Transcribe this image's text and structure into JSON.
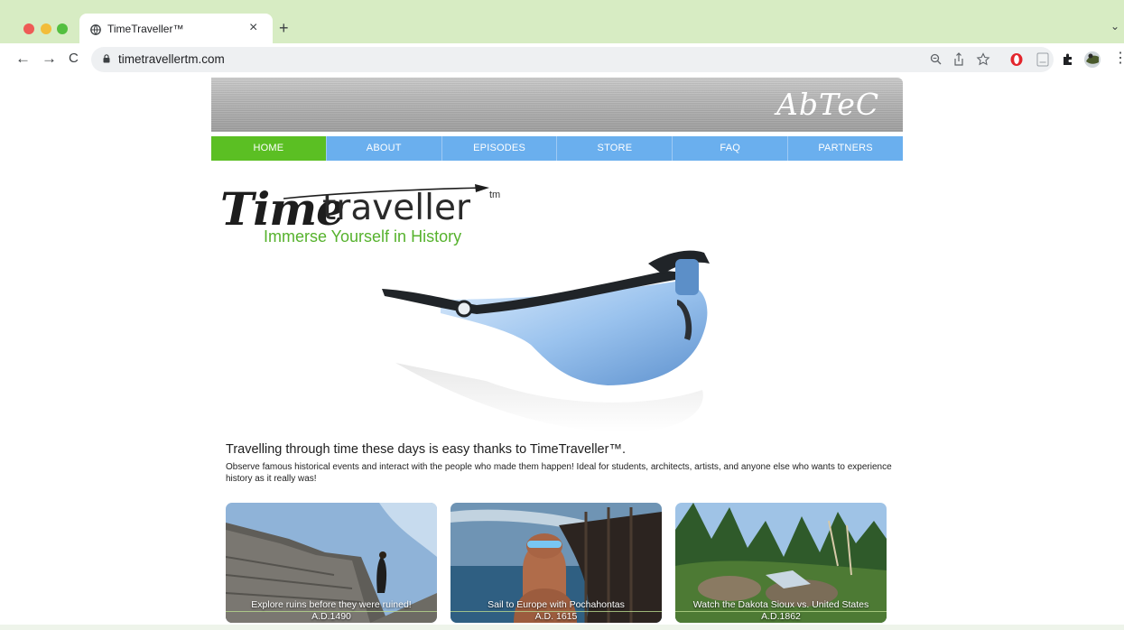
{
  "browser": {
    "tab_title": "TimeTraveller™",
    "tab_close": "×",
    "new_tab": "+",
    "tabs_menu": "⌄",
    "url": "timetravellertm.com",
    "nav": {
      "back": "←",
      "forward": "→",
      "reload": "C"
    },
    "toolbar_icons": [
      "zoom-icon",
      "share-icon",
      "bookmark-star-icon",
      "opera-icon",
      "document-icon",
      "extensions-puzzle-icon",
      "profile-avatar-icon",
      "kebab-menu-icon"
    ],
    "kebab": "⋮"
  },
  "site": {
    "banner_logo": "AbTeC",
    "nav": [
      {
        "label": "HOME",
        "active": true
      },
      {
        "label": "ABOUT",
        "active": false
      },
      {
        "label": "EPISODES",
        "active": false
      },
      {
        "label": "STORE",
        "active": false
      },
      {
        "label": "FAQ",
        "active": false
      },
      {
        "label": "PARTNERS",
        "active": false
      }
    ],
    "brand": {
      "script": "Time",
      "rest": "traveller",
      "tm": "tm"
    },
    "tagline": "Immerse Yourself in History",
    "intro_heading": "Travelling through time these days is easy thanks to TimeTraveller™.",
    "intro_body": "Observe famous historical events and interact with the people who made them happen! Ideal for students, architects, artists, and anyone else who wants to experience history as it really was!",
    "cards": [
      {
        "caption": "Explore ruins before they were ruined!",
        "date": "A.D.1490"
      },
      {
        "caption": "Sail to Europe with Pochahontas",
        "date": "A.D. 1615"
      },
      {
        "caption": "Watch the Dakota Sioux vs. United States",
        "date": "A.D.1862"
      }
    ]
  },
  "colors": {
    "tabstrip": "#d7ecc3",
    "nav_blue": "#6aafee",
    "nav_active": "#5bbf23",
    "tagline_green": "#56b22d"
  }
}
